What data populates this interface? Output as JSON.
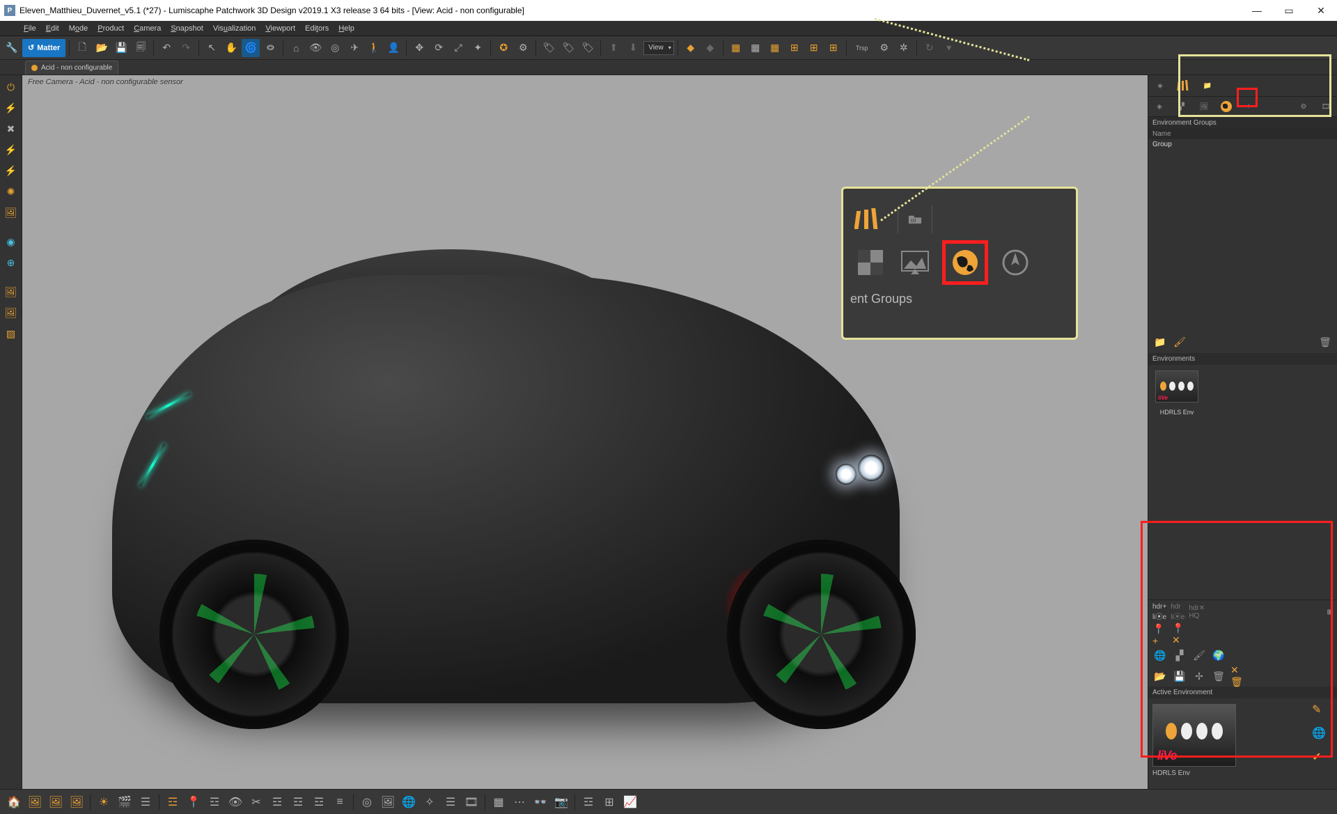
{
  "title": "Eleven_Matthieu_Duvernet_v5.1 (*27) - Lumiscaphe Patchwork 3D Design v2019.1 X3 release 3  64 bits - [View: Acid - non configurable]",
  "app_icon_letter": "P",
  "menu": {
    "file": "File",
    "edit": "Edit",
    "mode": "Mode",
    "product": "Product",
    "camera": "Camera",
    "snapshot": "Snapshot",
    "visualization": "Visualization",
    "viewport": "Viewport",
    "editors": "Editors",
    "help": "Help"
  },
  "main_toolbar": {
    "matter_label": "Matter",
    "view_label": "View"
  },
  "doc_tab": {
    "label": "Acid - non configurable"
  },
  "viewport": {
    "caption": "Free Camera - Acid - non configurable sensor"
  },
  "callout": {
    "label_fragment": "ent Groups"
  },
  "right_panel": {
    "env_groups_title": "Environment Groups",
    "col_name": "Name",
    "group_row": "Group",
    "environments_title": "Environments",
    "env_thumb_name": "HDRLS Env",
    "active_env_title": "Active Environment",
    "active_env_name": "HDRLS Env",
    "live_label": "liVe"
  },
  "icons": {
    "library": "library-icon",
    "folder_lib": "folder-library-icon",
    "checker": "checker-icon",
    "texture": "texture-picture-icon",
    "globe": "globe-environment-icon",
    "compass": "compass-icon",
    "pencil": "pencil-icon",
    "check": "check-icon"
  }
}
